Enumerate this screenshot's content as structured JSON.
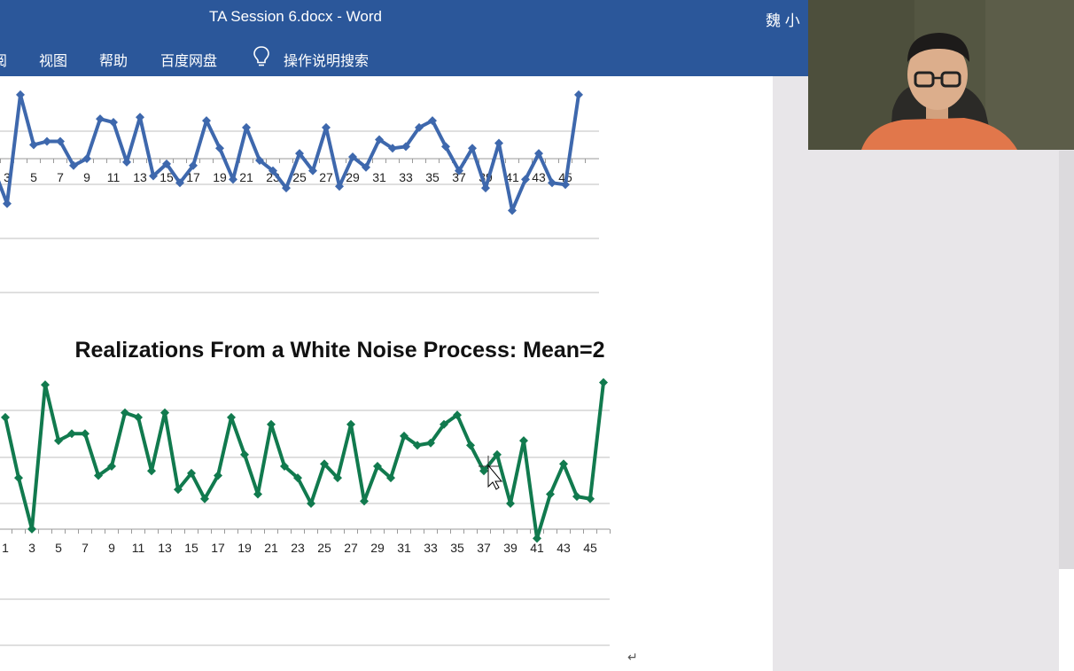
{
  "window": {
    "title": "TA Session 6.docx  -  Word",
    "user": "魏 小"
  },
  "ribbon": {
    "tabs": [
      "阅",
      "视图",
      "帮助",
      "百度网盘"
    ],
    "tell_me": "操作说明搜索",
    "tell_me_icon": "lightbulb-icon"
  },
  "colors": {
    "ribbon": "#2b579a",
    "series_blue": "#3e68ad",
    "series_green": "#117a4e",
    "gridline": "#bfbfbf",
    "side_panel": "#e8e6e9"
  },
  "document": {
    "paragraph_mark": "↵"
  },
  "chart_data": [
    {
      "type": "line",
      "title": "",
      "x": [
        1,
        2,
        3,
        4,
        5,
        6,
        7,
        8,
        9,
        10,
        11,
        12,
        13,
        14,
        15,
        16,
        17,
        18,
        19,
        20,
        21,
        22,
        23,
        24,
        25,
        26,
        27,
        28,
        29,
        30,
        31,
        32,
        33,
        34,
        35,
        36,
        37,
        38,
        39,
        40,
        41,
        42,
        43,
        44,
        45,
        46
      ],
      "x_tick_labels": [
        "3",
        "5",
        "7",
        "9",
        "11",
        "13",
        "15",
        "17",
        "19",
        "21",
        "23",
        "25",
        "27",
        "29",
        "31",
        "33",
        "35",
        "37",
        "39",
        "41",
        "43",
        "45"
      ],
      "series": [
        {
          "values": [
            0.6,
            -0.3,
            -1.3,
            1.85,
            0.4,
            0.5,
            0.5,
            -0.2,
            0,
            1.15,
            1.05,
            -0.1,
            1.2,
            -0.5,
            -0.15,
            -0.7,
            -0.2,
            1.1,
            0.3,
            -0.6,
            0.9,
            -0.05,
            -0.35,
            -0.85,
            0.15,
            -0.35,
            0.9,
            -0.8,
            0.05,
            -0.25,
            0.55,
            0.3,
            0.35,
            0.9,
            1.1,
            0.35,
            -0.35,
            0.3,
            -0.85,
            0.45,
            -1.5,
            -0.6,
            0.15,
            -0.7,
            -0.75,
            1.85
          ]
        }
      ],
      "x_axis_at": 0,
      "grid": true
    },
    {
      "type": "line",
      "title": "Realizations From a White Noise Process: Mean=2",
      "x": [
        1,
        2,
        3,
        4,
        5,
        6,
        7,
        8,
        9,
        10,
        11,
        12,
        13,
        14,
        15,
        16,
        17,
        18,
        19,
        20,
        21,
        22,
        23,
        24,
        25,
        26,
        27,
        28,
        29,
        30,
        31,
        32,
        33,
        34,
        35,
        36,
        37,
        38,
        39,
        40,
        41,
        42,
        43,
        44,
        45,
        46
      ],
      "x_tick_labels": [
        "1",
        "3",
        "5",
        "7",
        "9",
        "11",
        "13",
        "15",
        "17",
        "19",
        "21",
        "23",
        "25",
        "27",
        "29",
        "31",
        "33",
        "35",
        "37",
        "39",
        "41",
        "43",
        "45"
      ],
      "series": [
        {
          "values": [
            3.85,
            2.55,
            1.45,
            4.55,
            3.35,
            3.5,
            3.5,
            2.6,
            2.8,
            3.95,
            3.85,
            2.7,
            3.95,
            2.3,
            2.65,
            2.1,
            2.6,
            3.85,
            3.05,
            2.2,
            3.7,
            2.8,
            2.55,
            2,
            2.85,
            2.55,
            3.7,
            2.05,
            2.8,
            2.55,
            3.45,
            3.25,
            3.3,
            3.7,
            3.9,
            3.25,
            2.7,
            3.05,
            2,
            3.35,
            1.25,
            2.2,
            2.85,
            2.15,
            2.1,
            4.6
          ]
        }
      ],
      "grid": true
    }
  ]
}
